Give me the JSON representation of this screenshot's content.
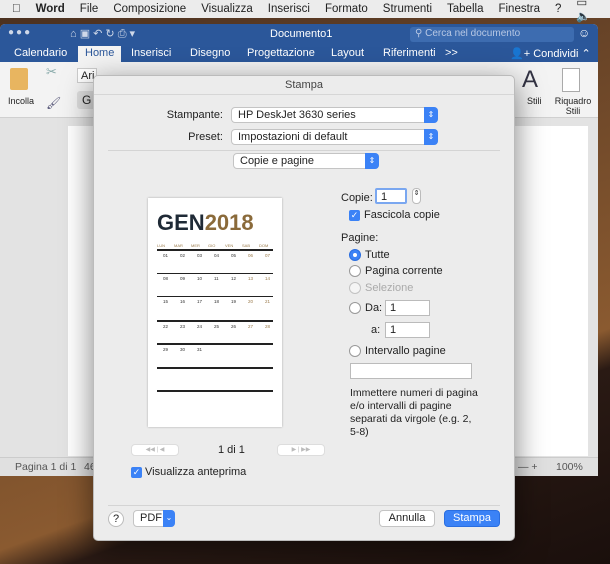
{
  "menubar": {
    "app": "Word",
    "items": [
      "File",
      "Composizione",
      "Visualizza",
      "Inserisci",
      "Formato",
      "Strumenti",
      "Tabella",
      "Finestra",
      "?"
    ]
  },
  "window": {
    "title": "Documento1",
    "search_placeholder": "Cerca nel documento",
    "tabs": [
      "Calendario",
      "Home",
      "Inserisci",
      "Disegno",
      "Progettazione",
      "Layout",
      "Riferimenti",
      ">>"
    ],
    "active_tab": "Home",
    "share": "Condividi",
    "paste": "Incolla",
    "font_partial": "Ari",
    "styles": "Stili",
    "styles_pane": "Riquadro Stili",
    "bold_partial": "G"
  },
  "status": {
    "page": "Pagina 1 di 1",
    "words_partial": "46",
    "zoom": "100%"
  },
  "dialog": {
    "title": "Stampa",
    "printer_label": "Stampante:",
    "printer": "HP DeskJet 3630 series",
    "preset_label": "Preset:",
    "preset": "Impostazioni di default",
    "section": "Copie e pagine",
    "copies_label": "Copie:",
    "copies": "1",
    "collate": "Fascicola copie",
    "collate_checked": true,
    "pages_label": "Pagine:",
    "opt_all": "Tutte",
    "opt_current": "Pagina corrente",
    "opt_selection": "Selezione",
    "opt_from": "Da:",
    "from": "1",
    "to_label": "a:",
    "to": "1",
    "opt_range": "Intervallo pagine",
    "range_value": "",
    "selected": "Tutte",
    "help": "Immettere numeri di pagina e/o intervalli di pagine separati da virgole (e.g. 2, 5-8)",
    "page_counter": "1 di 1",
    "show_preview": "Visualizza anteprima",
    "show_preview_checked": true,
    "help_button": "?",
    "pdf": "PDF",
    "cancel": "Annulla",
    "print": "Stampa",
    "accent": "#3b82f6"
  },
  "preview": {
    "title_a": "GEN",
    "title_b": "2018",
    "title_a_color": "#1f2a36",
    "title_b_color": "#8a6a3a",
    "weekdays": [
      "LUN",
      "MAR",
      "MER",
      "GIO",
      "VEN",
      "SAB",
      "DOM"
    ],
    "weeks": [
      [
        "01",
        "02",
        "03",
        "04",
        "05",
        "06",
        "07"
      ],
      [
        "08",
        "09",
        "10",
        "11",
        "12",
        "13",
        "14"
      ],
      [
        "15",
        "16",
        "17",
        "18",
        "19",
        "20",
        "21"
      ],
      [
        "22",
        "23",
        "24",
        "25",
        "26",
        "27",
        "28"
      ],
      [
        "29",
        "30",
        "31",
        "",
        "",
        "",
        ""
      ],
      [
        "",
        "",
        "",
        "",
        "",
        "",
        ""
      ],
      [
        "",
        "",
        "",
        "",
        "",
        "",
        ""
      ]
    ]
  }
}
